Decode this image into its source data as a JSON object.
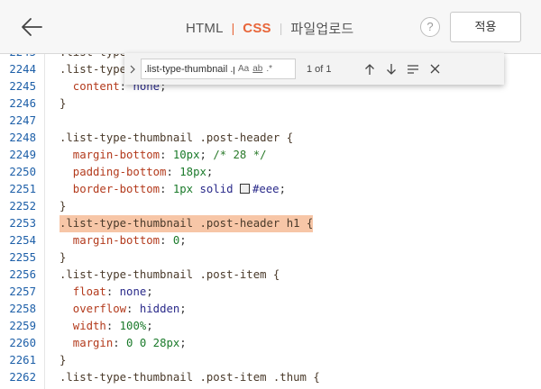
{
  "header": {
    "tabs": [
      "HTML",
      "CSS",
      "파일업로드"
    ],
    "active_tab": "CSS",
    "help_label": "?",
    "apply_label": "적용"
  },
  "find": {
    "query": ".list-type-thumbnail .post-hea",
    "match_case": "Aa",
    "whole_word": "ab",
    "regex": ".*",
    "count": "1 of 1"
  },
  "code_lines": [
    {
      "n": "2245",
      "t": ".list-type-thumbnail .post-header h1 {",
      "hl": false
    },
    {
      "n": "2244",
      "t": ".list-type-",
      "hl": false
    },
    {
      "n": "2245",
      "t": "  content: none;",
      "hl": false
    },
    {
      "n": "2246",
      "t": "}",
      "hl": false
    },
    {
      "n": "2247",
      "t": "",
      "hl": false
    },
    {
      "n": "2248",
      "t": ".list-type-thumbnail .post-header {",
      "hl": false
    },
    {
      "n": "2249",
      "t": "  margin-bottom: 10px; /* 28 */",
      "hl": false
    },
    {
      "n": "2250",
      "t": "  padding-bottom: 18px;",
      "hl": false
    },
    {
      "n": "2251",
      "t": "  border-bottom: 1px solid #eee;",
      "hl": false
    },
    {
      "n": "2252",
      "t": "}",
      "hl": false
    },
    {
      "n": "2253",
      "t": ".list-type-thumbnail .post-header h1 {",
      "hl": true
    },
    {
      "n": "2254",
      "t": "  margin-bottom: 0;",
      "hl": false
    },
    {
      "n": "2255",
      "t": "}",
      "hl": false
    },
    {
      "n": "2256",
      "t": ".list-type-thumbnail .post-item {",
      "hl": false
    },
    {
      "n": "2257",
      "t": "  float: none;",
      "hl": false
    },
    {
      "n": "2258",
      "t": "  overflow: hidden;",
      "hl": false
    },
    {
      "n": "2259",
      "t": "  width: 100%;",
      "hl": false
    },
    {
      "n": "2260",
      "t": "  margin: 0 0 28px;",
      "hl": false
    },
    {
      "n": "2261",
      "t": "}",
      "hl": false
    },
    {
      "n": "2262",
      "t": ".list-type-thumbnail .post-item .thum {",
      "hl": false
    }
  ],
  "colors": {
    "accent": "#e8663a",
    "line_number": "#1d5fa8",
    "highlight": "#f7c6a7",
    "swatch": "#eeeeee"
  }
}
